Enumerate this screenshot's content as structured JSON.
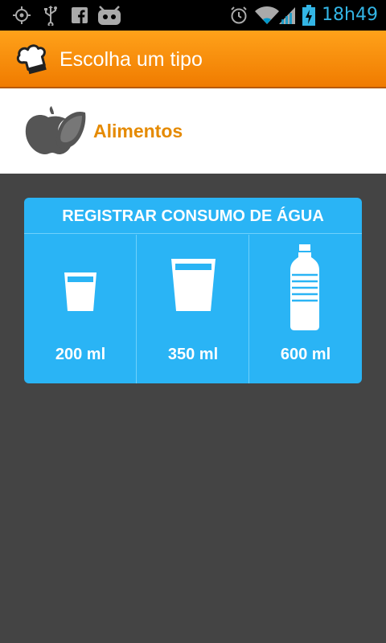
{
  "status_bar": {
    "time": "18h49",
    "icons": [
      "gps-icon",
      "usb-icon",
      "facebook-icon",
      "android-icon",
      "alarm-icon",
      "wifi-icon",
      "signal-icon",
      "battery-charging-icon"
    ]
  },
  "action_bar": {
    "title": "Escolha um tipo",
    "logo_icon": "chef-hat-icon"
  },
  "food_row": {
    "label": "Alimentos",
    "icon": "apple-icon"
  },
  "water": {
    "title": "REGISTRAR CONSUMO DE ÁGUA",
    "options": [
      {
        "label": "200 ml",
        "icon": "small-glass-icon"
      },
      {
        "label": "350 ml",
        "icon": "large-glass-icon"
      },
      {
        "label": "600 ml",
        "icon": "bottle-icon"
      }
    ]
  },
  "colors": {
    "accent_orange": "#f38b00",
    "food_label": "#e58a00",
    "water_card": "#2ab4f5",
    "background": "#444444",
    "status_time": "#33b5e5"
  }
}
